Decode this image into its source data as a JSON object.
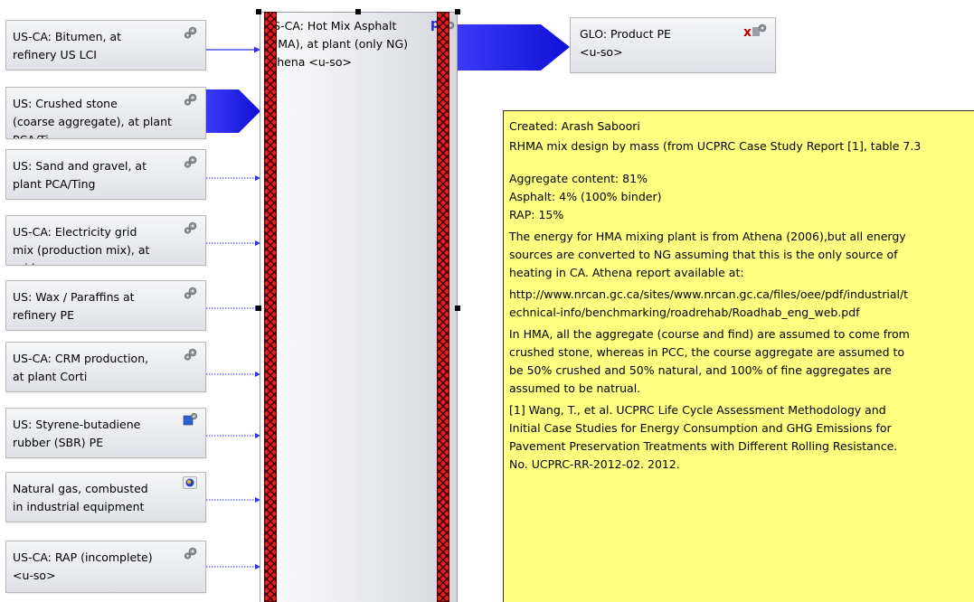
{
  "inputs": [
    {
      "label": "US-CA: Bitumen, at\nrefinery US LCI",
      "icon": "gear-icon"
    },
    {
      "label": "US: Crushed stone\n(coarse aggregate), at plant\nPCA/Ti",
      "icon": "gear-icon"
    },
    {
      "label": "US: Sand and gravel, at\nplant PCA/Ting",
      "icon": "gear-icon"
    },
    {
      "label": "US-CA:  Electricity grid\nmix (production mix), at grid",
      "icon": "gear-icon"
    },
    {
      "label": "US: Wax / Paraffins at\nrefinery PE",
      "icon": "gear-icon"
    },
    {
      "label": "US-CA: CRM production,\nat plant Corti",
      "icon": "gear-icon"
    },
    {
      "label": "US: Styrene-butadiene\nrubber (SBR) PE",
      "icon": "blue-plan-gear-icon"
    },
    {
      "label": "Natural gas, combusted\nin industrial equipment",
      "icon": "globe-icon"
    },
    {
      "label": "US-CA: RAP (incomplete)\n<u-so>",
      "icon": "gear-icon"
    }
  ],
  "main_process": {
    "label": "US-CA: Hot Mix Asphalt\n(HMA), at plant (only NG)\nAthena <u-so>",
    "marker": "p",
    "icon": "gear-icon"
  },
  "output": {
    "label": "GLO: Product PE\n<u-so>",
    "x_mark": "x",
    "icon": "gear-icon"
  },
  "note": {
    "lines": [
      "Created: Arash Saboori",
      "RHMA mix design by mass (from UCPRC Case Study Report [1], table 7.3",
      "",
      "Aggregate content: 81%",
      "Asphalt: 4% (100% binder)",
      "RAP: 15%",
      "The energy for HMA mixing plant is from Athena (2006),but all energy",
      "sources are converted to NG assuming that this is the only source of",
      "heating in CA. Athena report available at:",
      "http://www.nrcan.gc.ca/sites/www.nrcan.gc.ca/files/oee/pdf/industrial/t",
      "echnical-info/benchmarking/roadrehab/Roadhab_eng_web.pdf",
      "In HMA, all the aggregate (course and find) are assumed to come from",
      "crushed stone, whereas in PCC, the course aggregate are assumed to",
      "be 50% crushed and 50% natural, and 100% of fine aggregates are",
      "assumed to be natrual.",
      "[1] Wang, T., et al. UCPRC Life Cycle Assessment Methodology and",
      "Initial Case Studies for Energy Consumption and GHG Emissions for",
      "Pavement Preservation Treatments with Different Rolling Resistance.",
      "No. UCPRC-RR-2012-02. 2012."
    ]
  },
  "colors": {
    "flow_arrow": "#2a2af0",
    "note_background": "#ffff80",
    "bar_red": "#e02020"
  }
}
